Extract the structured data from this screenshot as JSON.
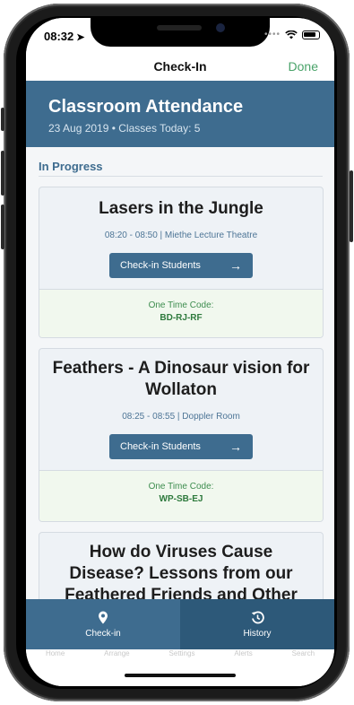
{
  "status_bar": {
    "time": "08:32",
    "location_arrow": "➤"
  },
  "nav": {
    "title": "Check-In",
    "done": "Done"
  },
  "header": {
    "title": "Classroom Attendance",
    "subtitle": "23 Aug 2019 • Classes Today: 5"
  },
  "section": {
    "title": "In Progress"
  },
  "classes": [
    {
      "title": "Lasers in the Jungle",
      "meta": "08:20 - 08:50 | Miethe Lecture Theatre",
      "button": "Check-in Students",
      "code_label": "One Time Code:",
      "code": "BD-RJ-RF"
    },
    {
      "title": "Feathers - A Dinosaur vision for Wollaton",
      "meta": "08:25 - 08:55 | Doppler Room",
      "button": "Check-in Students",
      "code_label": "One Time Code:",
      "code": "WP-SB-EJ"
    },
    {
      "title": "How do Viruses Cause Disease? Lessons from our Feathered Friends and Other"
    }
  ],
  "tabs": [
    {
      "label": "Check-in",
      "icon": "map-marker-icon"
    },
    {
      "label": "History",
      "icon": "history-icon"
    }
  ],
  "ghost_tabs": [
    "Home",
    "Arrange",
    "Settings",
    "Alerts",
    "Search"
  ],
  "colors": {
    "primary": "#3e6c8f",
    "primary_dark": "#2d5979",
    "accent_green": "#4aa36a",
    "code_green": "#2e7a3d"
  }
}
